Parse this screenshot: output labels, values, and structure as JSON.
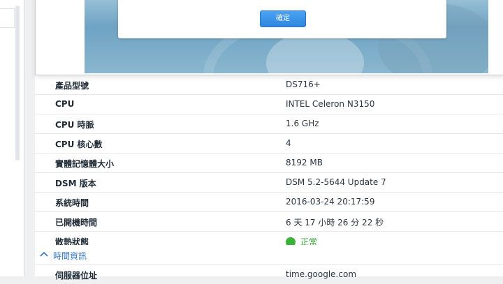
{
  "dialog": {
    "ok_button": "確定"
  },
  "info_rows": [
    {
      "label": "產品型號",
      "value": "DS716+"
    },
    {
      "label": "CPU",
      "value": "INTEL Celeron N3150"
    },
    {
      "label": "CPU 時脈",
      "value": "1.6 GHz"
    },
    {
      "label": "CPU 核心數",
      "value": "4"
    },
    {
      "label": "實體記憶體大小",
      "value": "8192 MB"
    },
    {
      "label": "DSM 版本",
      "value": "DSM 5.2-5644 Update 7"
    },
    {
      "label": "系統時間",
      "value": "2016-03-24 20:17:59"
    },
    {
      "label": "已開機時間",
      "value": "6 天 17 小時 26 分 22 秒"
    },
    {
      "label": "散熱狀態",
      "value": "正常"
    }
  ],
  "time_section": {
    "title": "時間資訊",
    "row_label": "伺服器位址",
    "row_value": "time.google.com"
  },
  "colors": {
    "status_ok": "#3bb33b",
    "accent": "#3477c5"
  }
}
